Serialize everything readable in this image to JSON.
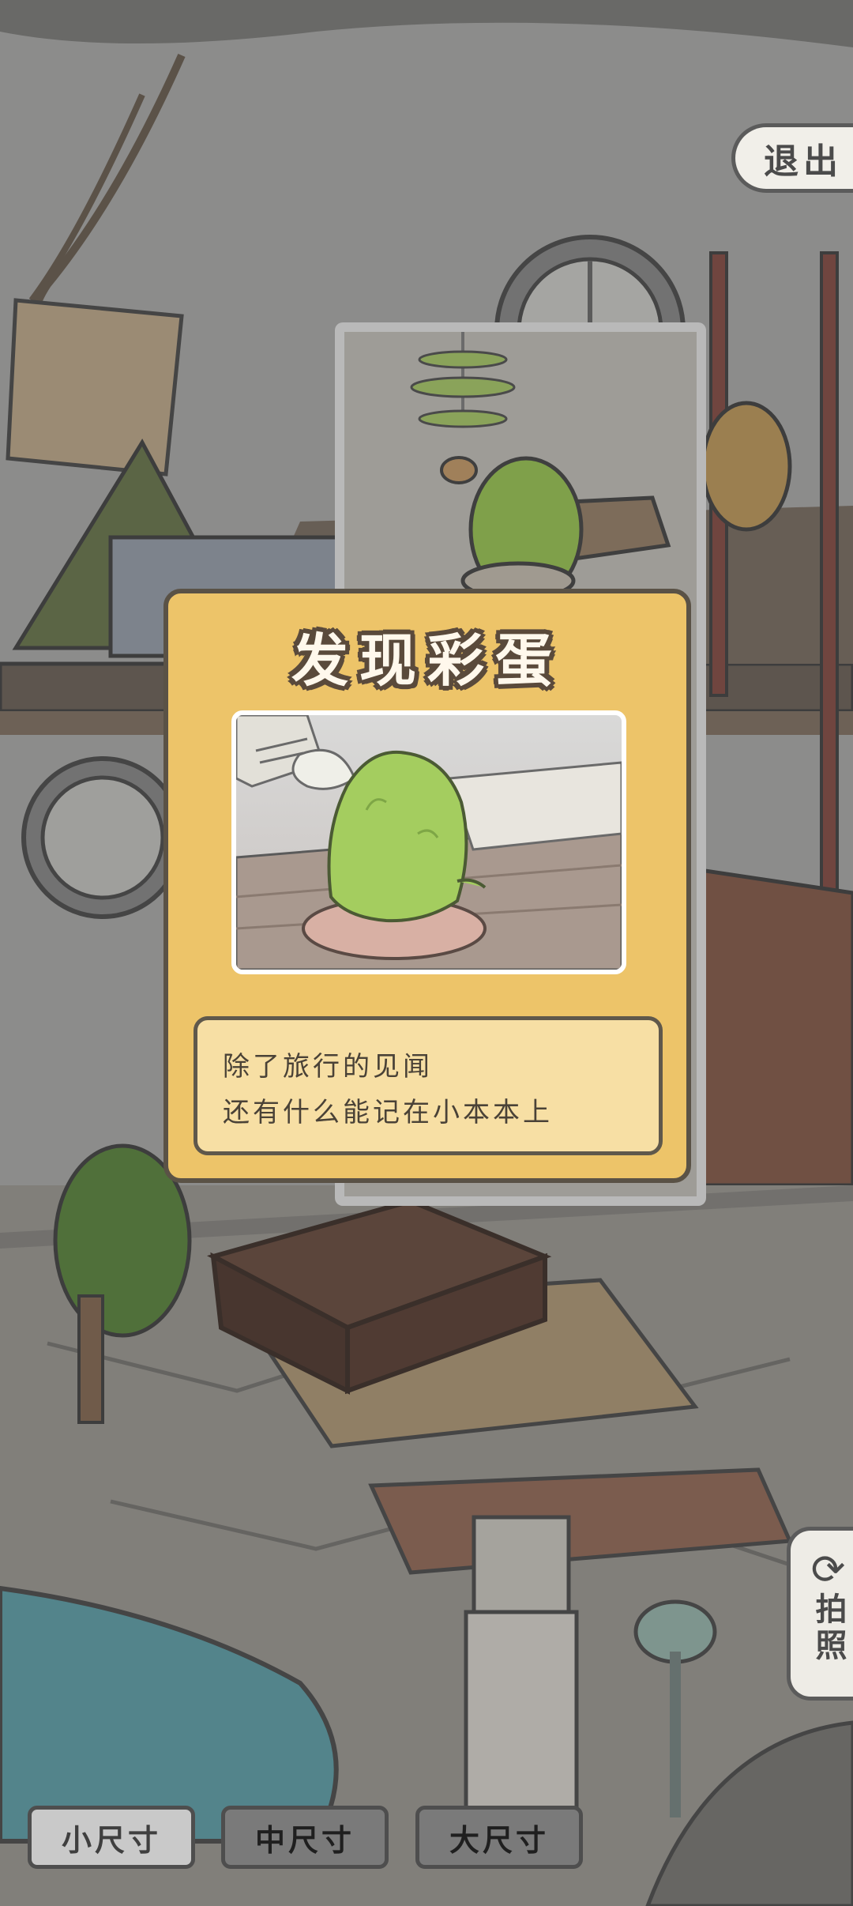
{
  "exit_button": {
    "label": "退出"
  },
  "card": {
    "title": "发现彩蛋",
    "lines": [
      "除了旅行的见闻",
      "还有什么能记在小本本上"
    ]
  },
  "photo_button": {
    "label": "拍照",
    "icon": "refresh-icon"
  },
  "size_options": [
    {
      "label": "小尺寸",
      "selected": true
    },
    {
      "label": "中尺寸",
      "selected": false
    },
    {
      "label": "大尺寸",
      "selected": false
    }
  ],
  "colors": {
    "card": "#edc469",
    "card_text_box": "#f7dfa4",
    "frog": "#9cc45a",
    "outline": "#5a5246"
  }
}
